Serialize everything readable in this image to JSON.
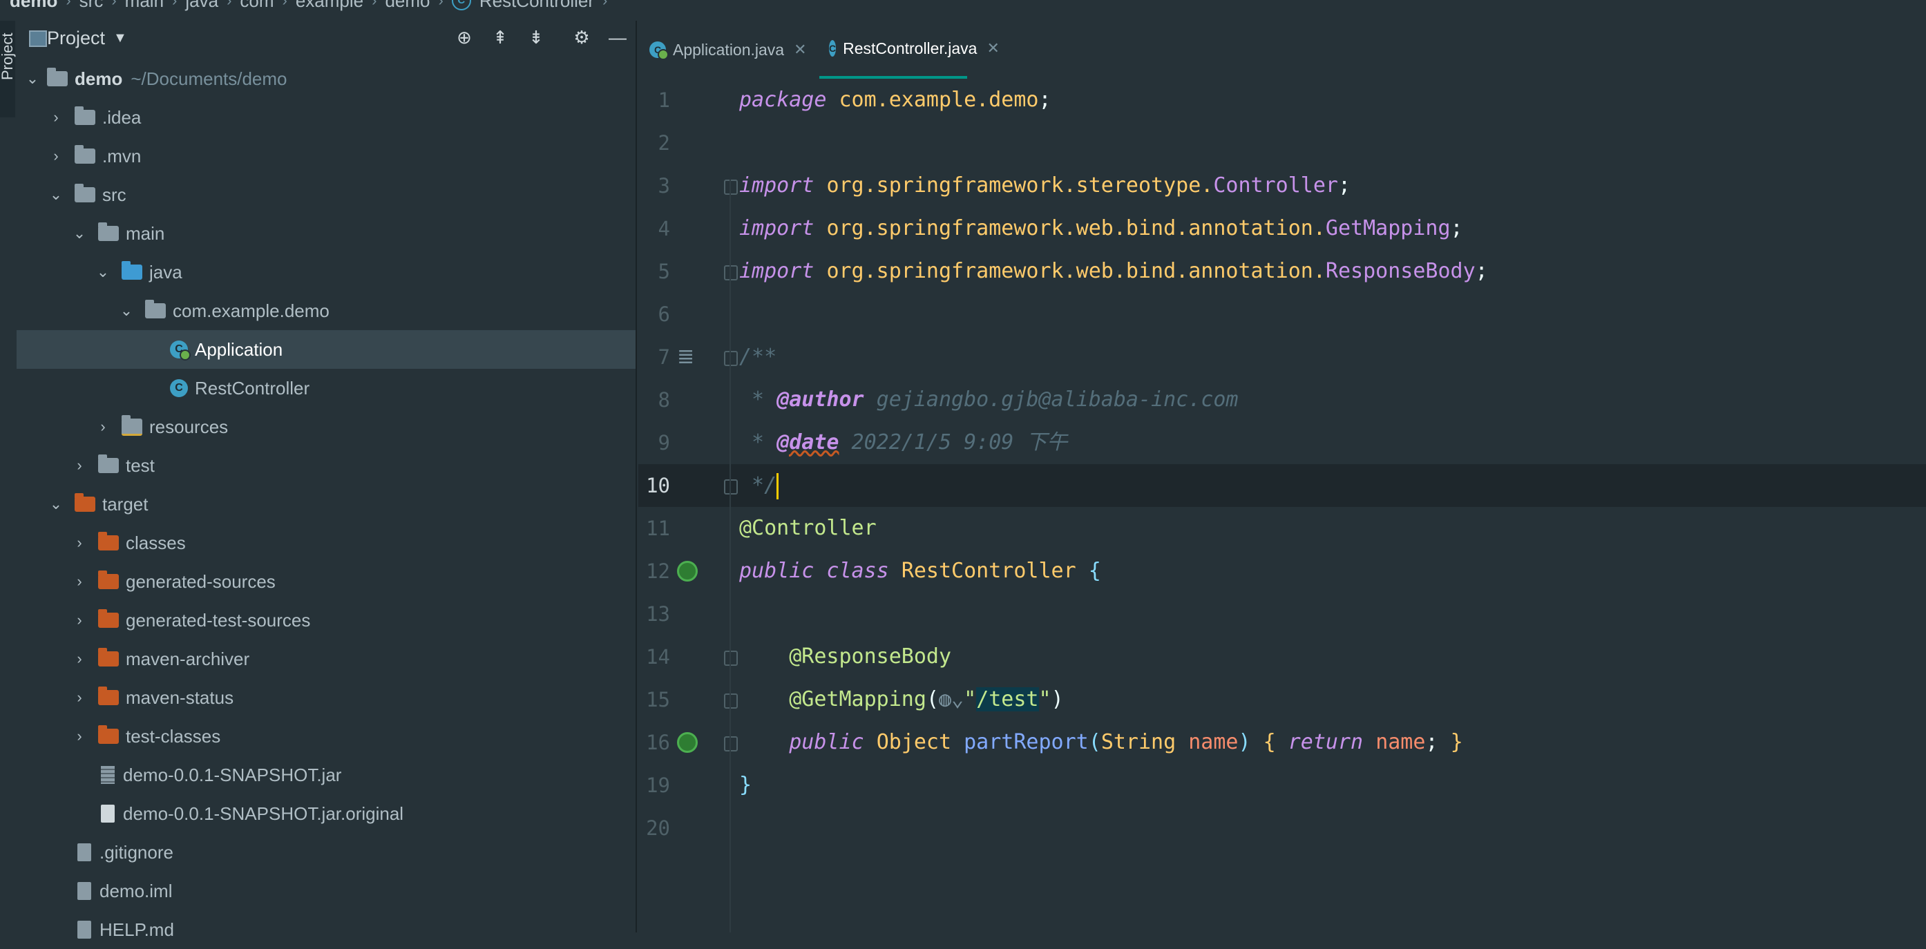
{
  "breadcrumb": [
    "demo",
    "src",
    "main",
    "java",
    "com",
    "example",
    "demo",
    "RestController"
  ],
  "side_strip_label": "Project",
  "project_panel": {
    "title": "Project",
    "tree": [
      {
        "label": "demo",
        "suffix": "~/Documents/demo",
        "icon": "module-folder-icon",
        "expanded": true,
        "depth": 0
      },
      {
        "label": ".idea",
        "icon": "folder-icon",
        "expanded": false,
        "depth": 1
      },
      {
        "label": ".mvn",
        "icon": "folder-icon",
        "expanded": false,
        "depth": 1
      },
      {
        "label": "src",
        "icon": "folder-icon",
        "expanded": true,
        "depth": 1
      },
      {
        "label": "main",
        "icon": "folder-icon",
        "expanded": true,
        "depth": 2
      },
      {
        "label": "java",
        "icon": "source-folder-icon",
        "expanded": true,
        "depth": 3
      },
      {
        "label": "com.example.demo",
        "icon": "package-icon",
        "expanded": true,
        "depth": 4
      },
      {
        "label": "Application",
        "icon": "spring-class-icon",
        "depth": 5,
        "selected": true
      },
      {
        "label": "RestController",
        "icon": "class-icon",
        "depth": 5
      },
      {
        "label": "resources",
        "icon": "resources-folder-icon",
        "expanded": false,
        "depth": 3
      },
      {
        "label": "test",
        "icon": "folder-icon",
        "expanded": false,
        "depth": 2
      },
      {
        "label": "target",
        "icon": "excluded-folder-icon",
        "expanded": true,
        "depth": 1
      },
      {
        "label": "classes",
        "icon": "excluded-folder-icon",
        "expanded": false,
        "depth": 2
      },
      {
        "label": "generated-sources",
        "icon": "excluded-folder-icon",
        "expanded": false,
        "depth": 2
      },
      {
        "label": "generated-test-sources",
        "icon": "excluded-folder-icon",
        "expanded": false,
        "depth": 2
      },
      {
        "label": "maven-archiver",
        "icon": "excluded-folder-icon",
        "expanded": false,
        "depth": 2
      },
      {
        "label": "maven-status",
        "icon": "excluded-folder-icon",
        "expanded": false,
        "depth": 2
      },
      {
        "label": "test-classes",
        "icon": "excluded-folder-icon",
        "expanded": false,
        "depth": 2
      },
      {
        "label": "demo-0.0.1-SNAPSHOT.jar",
        "icon": "jar-icon",
        "depth": 2
      },
      {
        "label": "demo-0.0.1-SNAPSHOT.jar.original",
        "icon": "file-icon",
        "depth": 2
      },
      {
        "label": ".gitignore",
        "icon": "gitignore-icon",
        "depth": 1
      },
      {
        "label": "demo.iml",
        "icon": "iml-icon",
        "depth": 1
      },
      {
        "label": "HELP.md",
        "icon": "markdown-icon",
        "depth": 1
      }
    ]
  },
  "tabs": [
    {
      "label": "Application.java",
      "active": false
    },
    {
      "label": "RestController.java",
      "active": true
    }
  ],
  "editor": {
    "current_line": "10",
    "lines": [
      {
        "n": "1",
        "code": "package com.example.demo;"
      },
      {
        "n": "2",
        "code": ""
      },
      {
        "n": "3",
        "code": "import org.springframework.stereotype.Controller;"
      },
      {
        "n": "4",
        "code": "import org.springframework.web.bind.annotation.GetMapping;"
      },
      {
        "n": "5",
        "code": "import org.springframework.web.bind.annotation.ResponseBody;"
      },
      {
        "n": "6",
        "code": ""
      },
      {
        "n": "7",
        "code": "/**"
      },
      {
        "n": "8",
        "code": " * @author gejiangbo.gjb@alibaba-inc.com"
      },
      {
        "n": "9",
        "code": " * @date 2022/1/5 9:09 下午"
      },
      {
        "n": "10",
        "code": " */"
      },
      {
        "n": "11",
        "code": "@Controller"
      },
      {
        "n": "12",
        "code": "public class RestController {"
      },
      {
        "n": "13",
        "code": ""
      },
      {
        "n": "14",
        "code": "    @ResponseBody"
      },
      {
        "n": "15",
        "code": "    @GetMapping(\"/test\")"
      },
      {
        "n": "16",
        "code": "    public Object partReport(String name) { return name; }"
      },
      {
        "n": "19",
        "code": "}"
      },
      {
        "n": "20",
        "code": ""
      }
    ]
  },
  "colors": {
    "background": "#263238",
    "keyword": "#c792ea",
    "string": "#c3e88d",
    "class_name": "#ffcb6b",
    "function": "#82aaff",
    "comment": "#546e7a",
    "active_tab_underline": "#009688"
  }
}
